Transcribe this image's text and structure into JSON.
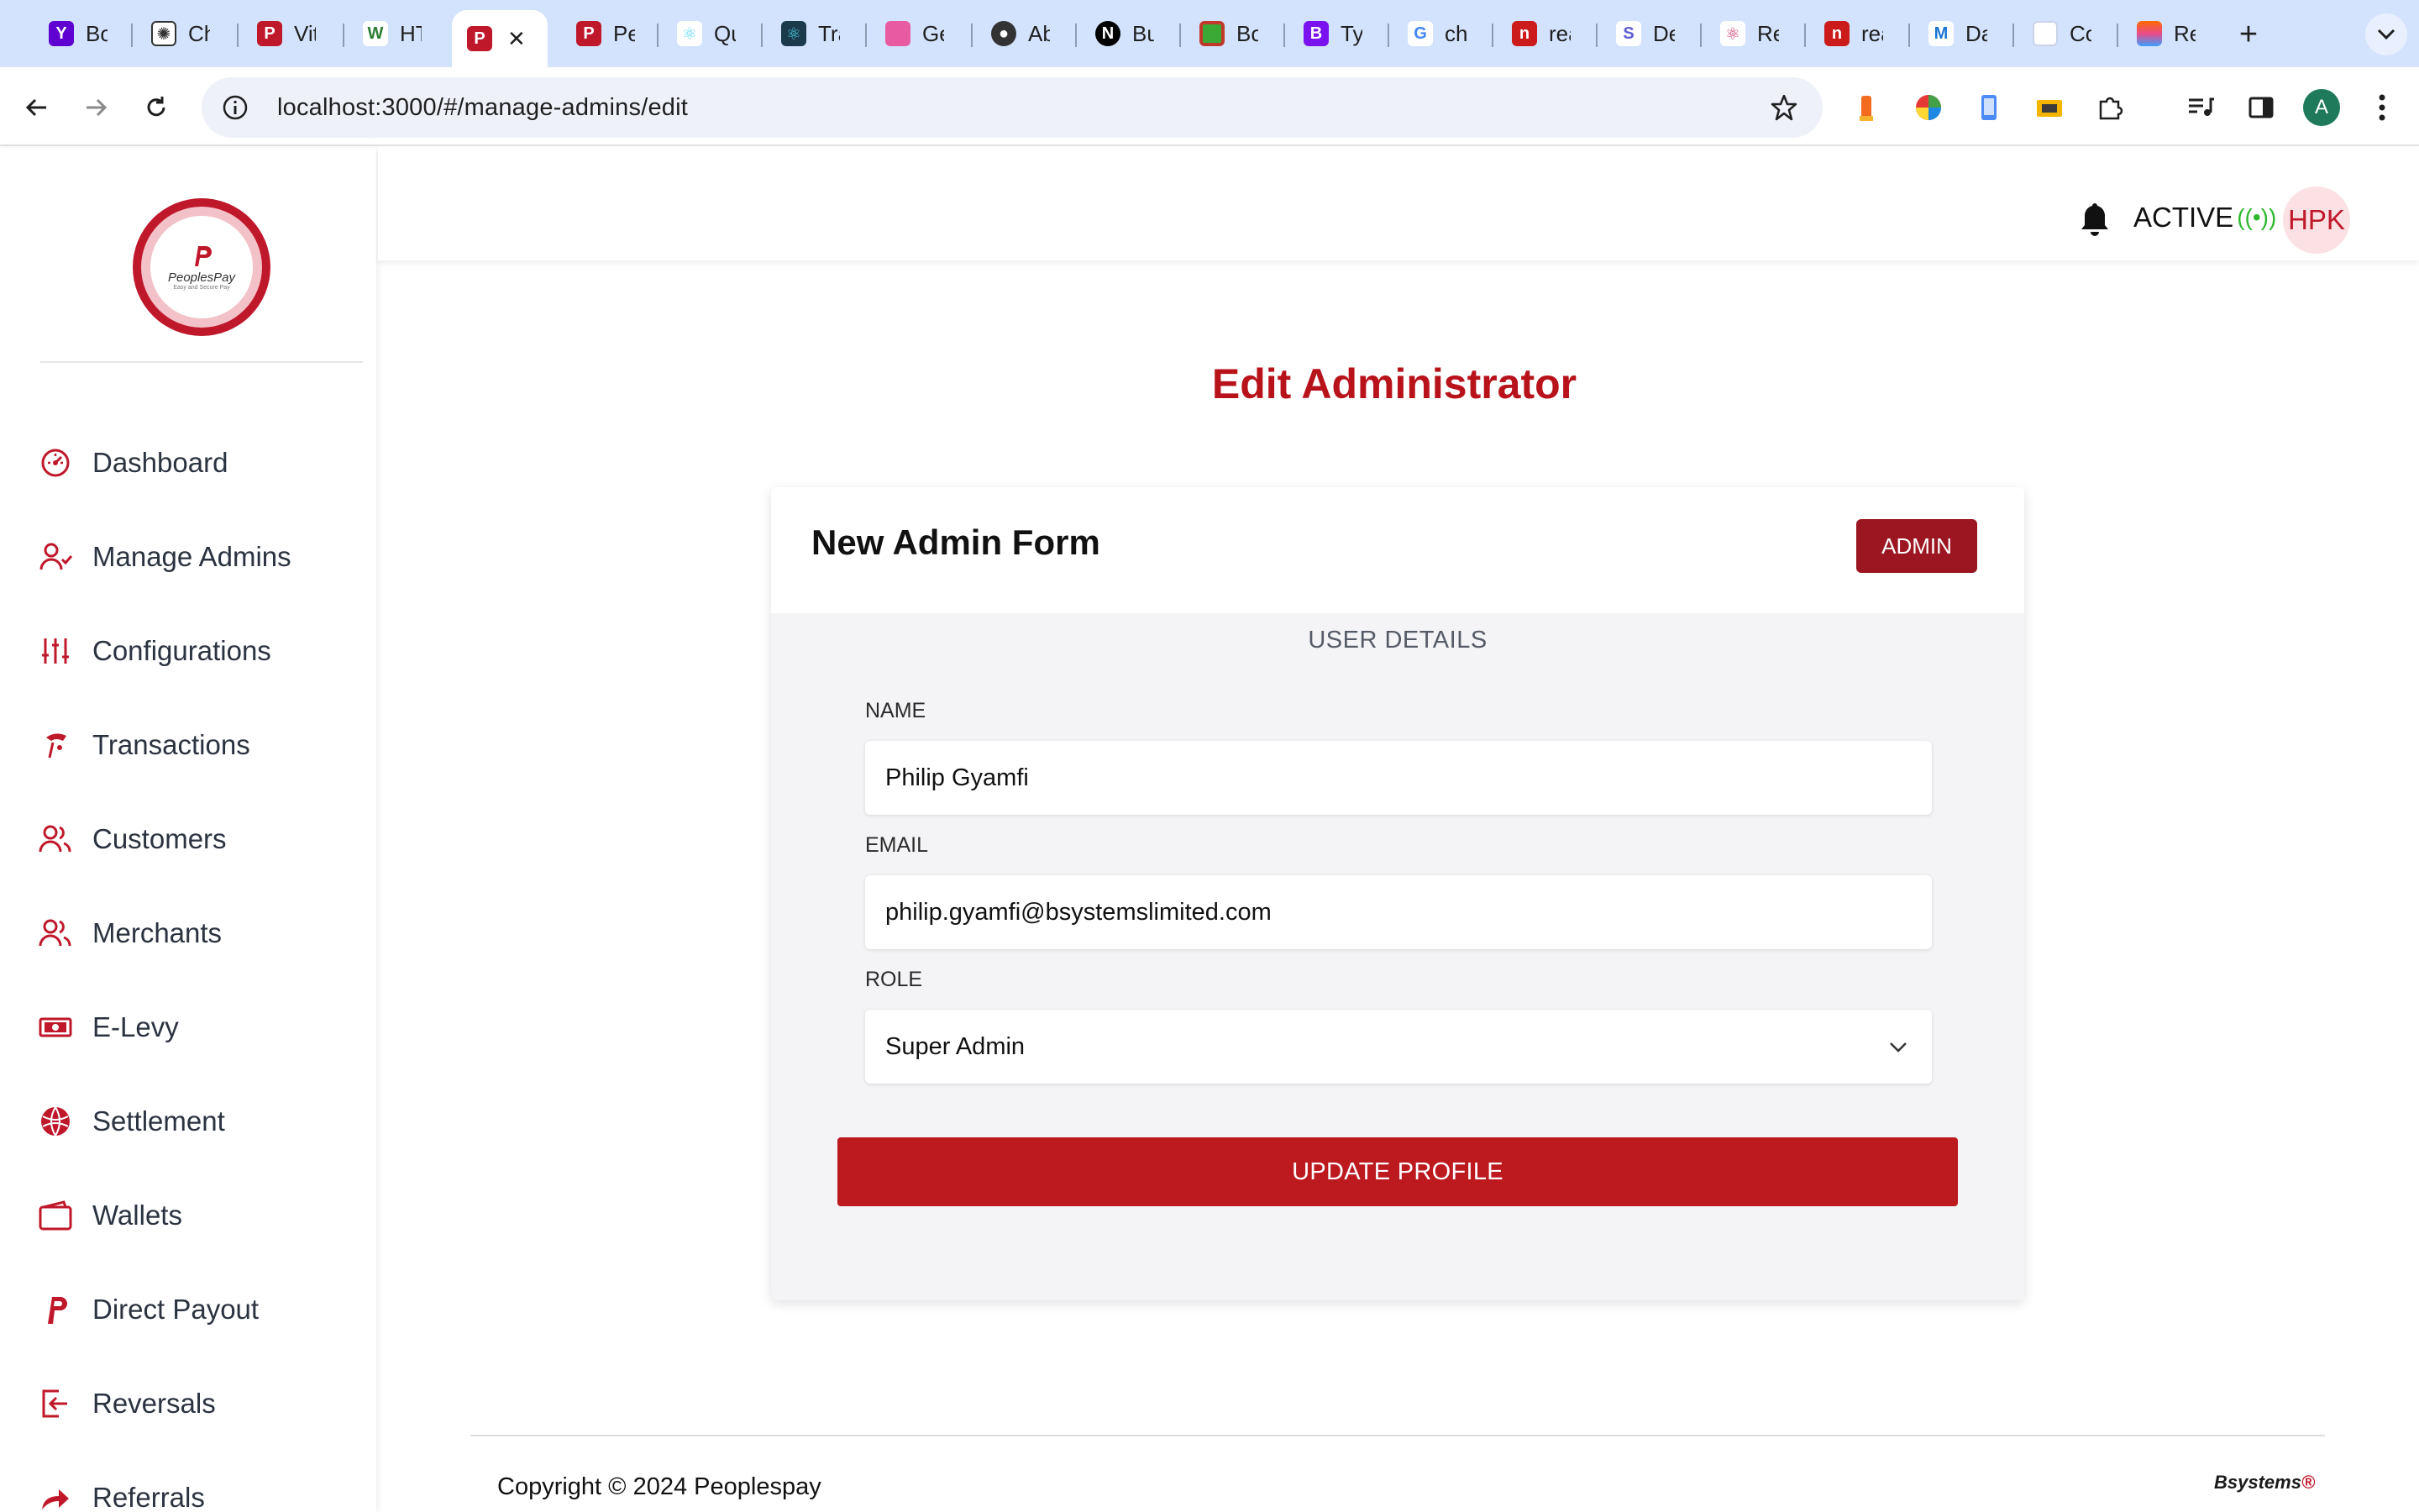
{
  "browser": {
    "tabs": [
      {
        "title": "Bo",
        "icon": "yahoo-icon",
        "color": "#5f01d1"
      },
      {
        "title": "Ch",
        "icon": "chatgpt-icon",
        "color": "#333333"
      },
      {
        "title": "Vit",
        "icon": "peoplespay-icon",
        "color": "#c0182b"
      },
      {
        "title": "HT",
        "icon": "w-icon",
        "color": "#2e7d32"
      },
      {
        "title": "",
        "icon": "peoplespay-icon",
        "color": "#c0182b",
        "active": true
      },
      {
        "title": "Pe",
        "icon": "peoplespay-icon",
        "color": "#c0182b"
      },
      {
        "title": "Qu",
        "icon": "react-icon",
        "color": "#61dafb"
      },
      {
        "title": "Tra",
        "icon": "electron-icon",
        "color": "#1b3a4b"
      },
      {
        "title": "Ge",
        "icon": "figma-icon",
        "color": "#e85ba3"
      },
      {
        "title": "Ab",
        "icon": "github-icon",
        "color": "#333333"
      },
      {
        "title": "Bu",
        "icon": "nextjs-icon",
        "color": "#000000"
      },
      {
        "title": "Bo",
        "icon": "green-square-icon",
        "color": "#3aa935"
      },
      {
        "title": "Ty",
        "icon": "bootstrap-icon",
        "color": "#7a12f0"
      },
      {
        "title": "chi",
        "icon": "google-icon",
        "color": "#4285f4"
      },
      {
        "title": "rea",
        "icon": "npm-icon",
        "color": "#cb1b1b"
      },
      {
        "title": "De",
        "icon": "stitches-icon",
        "color": "#5b5bd6"
      },
      {
        "title": "Re",
        "icon": "react-icon",
        "color": "#d6336c"
      },
      {
        "title": "rea",
        "icon": "npm-icon",
        "color": "#cb1b1b"
      },
      {
        "title": "Da",
        "icon": "mui-icon",
        "color": "#1976d2"
      },
      {
        "title": "Co",
        "icon": "blank-page-icon",
        "color": "#dfe6f5"
      },
      {
        "title": "Re",
        "icon": "rainbow-icon",
        "color": "#ff6a00"
      }
    ],
    "url": "localhost:3000/#/manage-admins/edit",
    "profile_initial": "A"
  },
  "sidebar": {
    "logo_text": "PeoplesPay",
    "logo_tagline": "Easy and Secure Pay",
    "items": [
      {
        "label": "Dashboard",
        "icon": "speedometer-icon"
      },
      {
        "label": "Manage Admins",
        "icon": "user-check-icon"
      },
      {
        "label": "Configurations",
        "icon": "sliders-icon"
      },
      {
        "label": "Transactions",
        "icon": "money-transfer-icon"
      },
      {
        "label": "Customers",
        "icon": "users-icon"
      },
      {
        "label": "Merchants",
        "icon": "users-icon"
      },
      {
        "label": "E-Levy",
        "icon": "cash-icon"
      },
      {
        "label": "Settlement",
        "icon": "globe-icon"
      },
      {
        "label": "Wallets",
        "icon": "wallet-icon"
      },
      {
        "label": "Direct Payout",
        "icon": "paypal-icon"
      },
      {
        "label": "Reversals",
        "icon": "exit-arrow-icon"
      },
      {
        "label": "Referrals",
        "icon": "share-arrow-icon"
      }
    ]
  },
  "header": {
    "status": "ACTIVE",
    "status_indicator": "((•))",
    "avatar_initials": "HPK"
  },
  "main": {
    "page_title": "Edit Administrator",
    "form": {
      "title": "New Admin Form",
      "badge": "ADMIN",
      "section_title": "USER DETAILS",
      "name_label": "NAME",
      "name_value": "Philip Gyamfi",
      "email_label": "EMAIL",
      "email_value": "philip.gyamfi@bsystemslimited.com",
      "role_label": "ROLE",
      "role_value": "Super Admin",
      "submit_label": "UPDATE PROFILE"
    }
  },
  "footer": {
    "copyright": "Copyright © 2024 Peoplespay",
    "logo": "Bsystems"
  },
  "colors": {
    "brand_red": "#bd1a20",
    "badge_red": "#9b1620",
    "title_red": "#b8121b",
    "status_green": "#2eb82e"
  }
}
